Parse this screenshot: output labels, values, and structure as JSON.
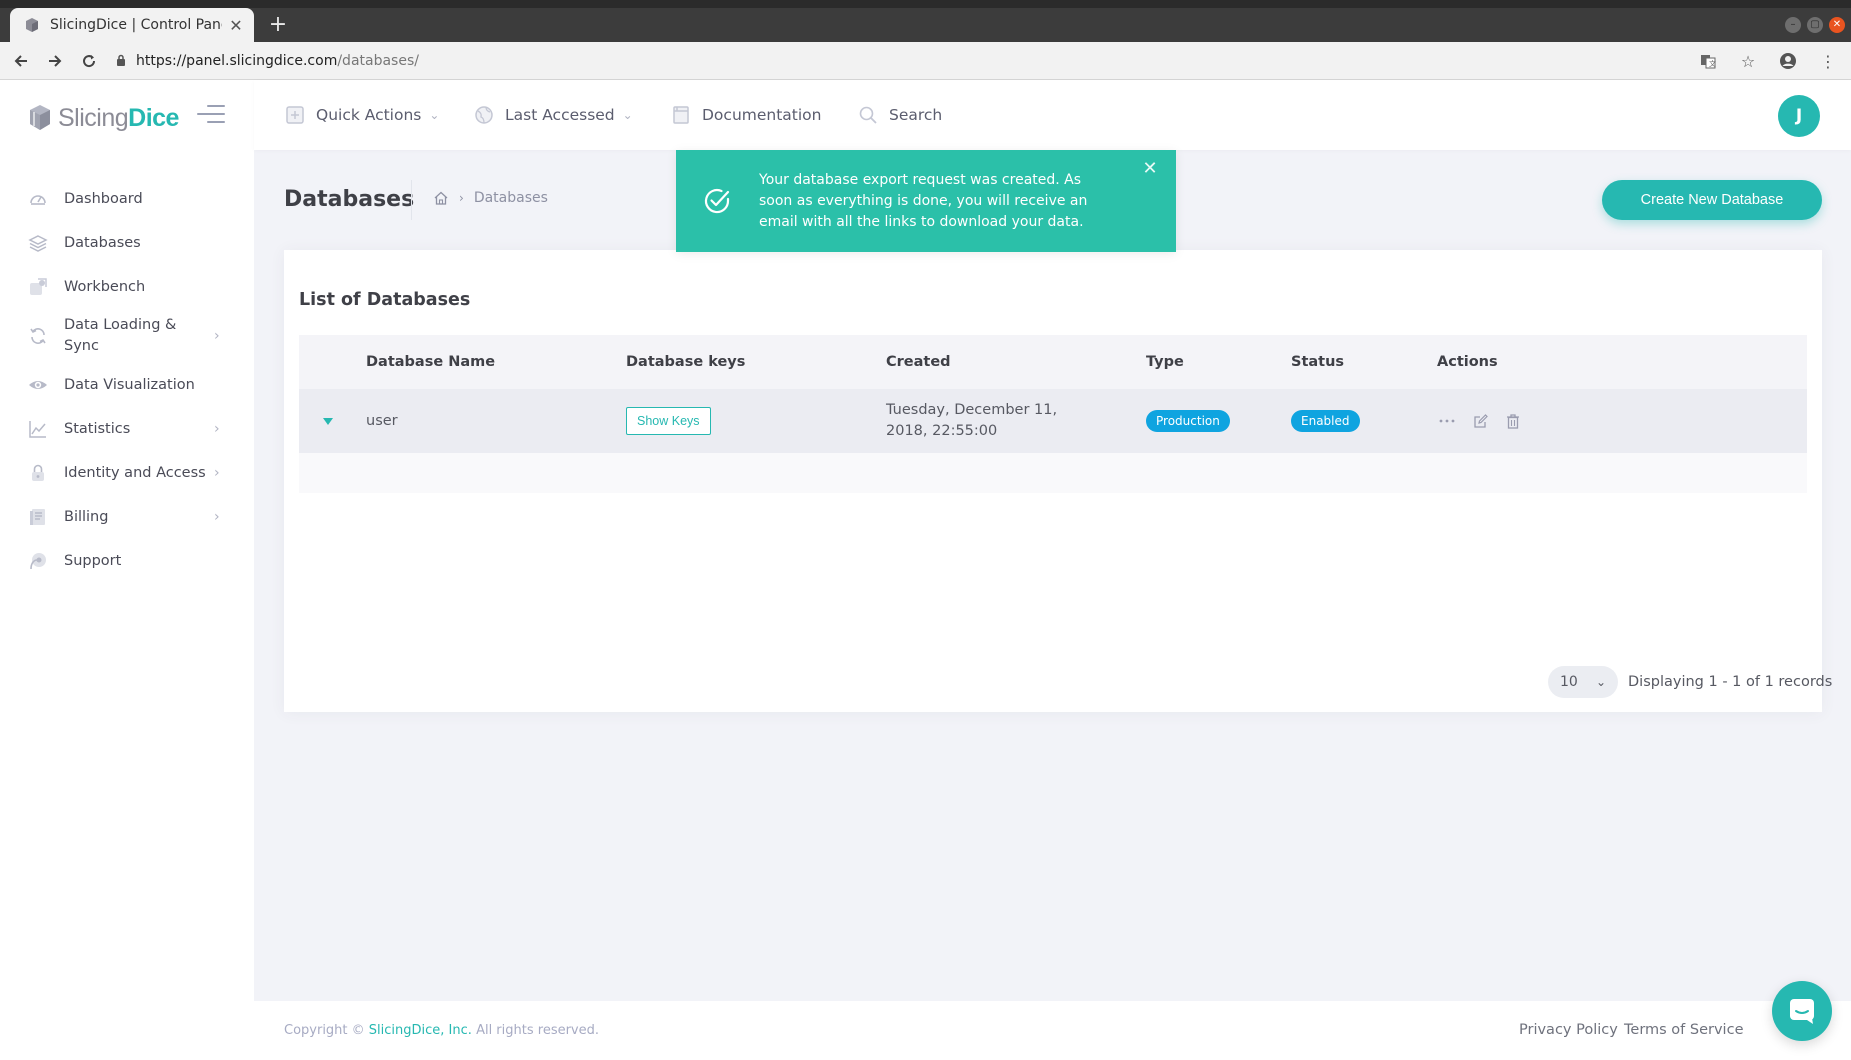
{
  "browser": {
    "tab_title": "SlicingDice | Control Pane",
    "url_host": "https://panel.slicingdice.com",
    "url_path": "/databases/"
  },
  "logo": {
    "slicing": "Slicing",
    "dice": "Dice"
  },
  "sidebar": {
    "items": [
      {
        "label": "Dashboard",
        "icon": "dashboard-icon",
        "has_arrow": false
      },
      {
        "label": "Databases",
        "icon": "layers-icon",
        "has_arrow": false
      },
      {
        "label": "Workbench",
        "icon": "workbench-icon",
        "has_arrow": false
      },
      {
        "label": "Data Loading & Sync",
        "icon": "sync-icon",
        "has_arrow": true
      },
      {
        "label": "Data Visualization",
        "icon": "eye-icon",
        "has_arrow": false
      },
      {
        "label": "Statistics",
        "icon": "chart-icon",
        "has_arrow": true
      },
      {
        "label": "Identity and Access",
        "icon": "lock-icon",
        "has_arrow": true
      },
      {
        "label": "Billing",
        "icon": "billing-icon",
        "has_arrow": true
      },
      {
        "label": "Support",
        "icon": "support-icon",
        "has_arrow": false
      }
    ]
  },
  "header": {
    "quick_actions": "Quick Actions",
    "last_accessed": "Last Accessed",
    "documentation": "Documentation",
    "search": "Search",
    "avatar_initial": "J"
  },
  "subheader": {
    "title": "Databases",
    "breadcrumb": "Databases",
    "create_button": "Create New Database"
  },
  "toast": {
    "message": "Your database export request was created. As soon as everything is done, you will receive an email with all the links to download your data."
  },
  "portlet": {
    "title": "List of Databases",
    "columns": [
      "Database Name",
      "Database keys",
      "Created",
      "Type",
      "Status",
      "Actions"
    ],
    "rows": [
      {
        "name": "user",
        "keys_button": "Show Keys",
        "created": "Tuesday, December 11, 2018, 22:55:00",
        "type": "Production",
        "status": "Enabled"
      }
    ],
    "page_size": "10",
    "page_info": "Displaying 1 - 1 of 1 records"
  },
  "footer": {
    "copyright_prefix": "Copyright ©",
    "company": "SlicingDice, Inc.",
    "rights": "All rights reserved.",
    "privacy": "Privacy Policy",
    "terms": "Terms of Service"
  },
  "colors": {
    "accent": "#26b8b1",
    "toast": "#2bc0a9",
    "badge": "#0fa4e0"
  }
}
